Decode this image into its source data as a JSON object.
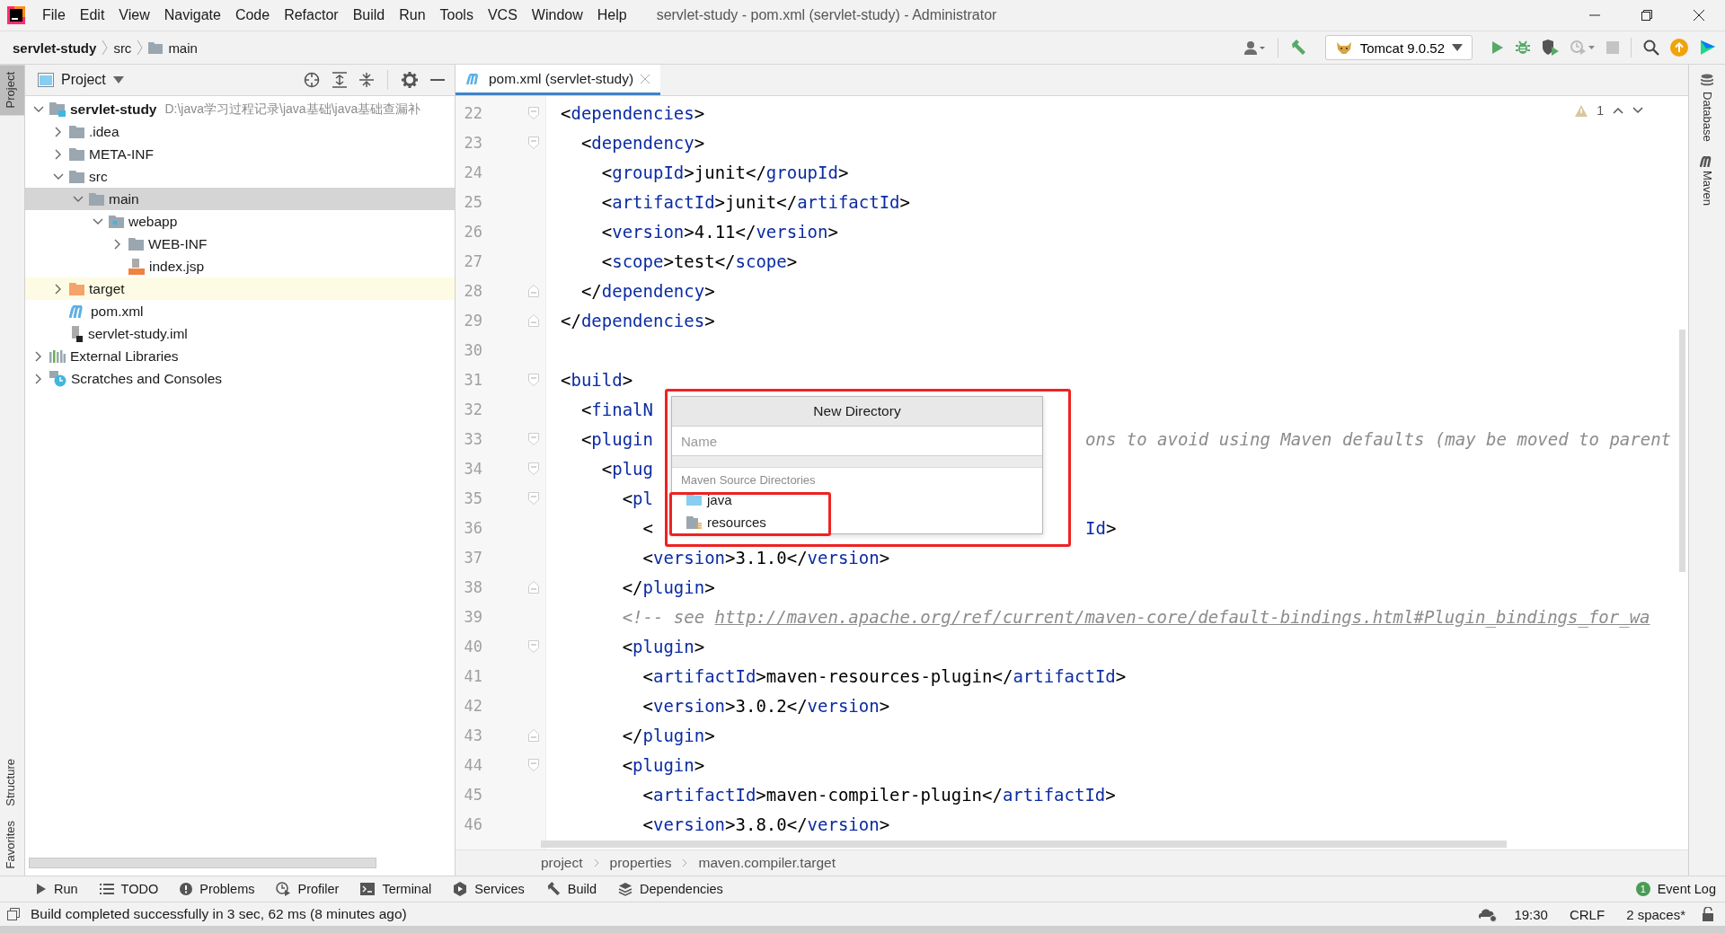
{
  "menu": [
    "File",
    "Edit",
    "View",
    "Navigate",
    "Code",
    "Refactor",
    "Build",
    "Run",
    "Tools",
    "VCS",
    "Window",
    "Help"
  ],
  "window_title": "servlet-study - pom.xml (servlet-study) - Administrator",
  "nav_path": [
    {
      "label": "servlet-study",
      "kind": "module"
    },
    {
      "label": "src",
      "kind": "plain"
    },
    {
      "label": "main",
      "kind": "folder"
    }
  ],
  "run_config": "Tomcat 9.0.52",
  "left_stripe": [
    {
      "label": "Project",
      "selected": true,
      "kind": "top"
    },
    {
      "label": "Structure",
      "selected": false,
      "kind": "bottom"
    },
    {
      "label": "Favorites",
      "selected": false,
      "kind": "bottom"
    }
  ],
  "right_stripe": [
    {
      "label": "Database",
      "kind": "database"
    },
    {
      "label": "Maven",
      "kind": "maven"
    }
  ],
  "project": {
    "title": "Project",
    "tree": [
      {
        "label": "servlet-study",
        "path": "D:\\java学习过程记录\\java基础\\java基础查漏补",
        "kind": "module",
        "expanded": true,
        "selected": false,
        "highlighted": false,
        "children": [
          {
            "label": ".idea",
            "kind": "folder",
            "expanded": false,
            "selected": false,
            "highlighted": false
          },
          {
            "label": "META-INF",
            "kind": "folder",
            "expanded": false,
            "selected": false,
            "highlighted": false
          },
          {
            "label": "src",
            "kind": "folder",
            "expanded": true,
            "selected": false,
            "highlighted": false,
            "children": [
              {
                "label": "main",
                "kind": "folder",
                "expanded": true,
                "selected": true,
                "highlighted": false,
                "children": [
                  {
                    "label": "webapp",
                    "kind": "web",
                    "expanded": true,
                    "selected": false,
                    "highlighted": false,
                    "children": [
                      {
                        "label": "WEB-INF",
                        "kind": "folder",
                        "expanded": false,
                        "selected": false,
                        "highlighted": false
                      },
                      {
                        "label": "index.jsp",
                        "kind": "jsp",
                        "selected": false,
                        "highlighted": false
                      }
                    ]
                  }
                ]
              }
            ]
          },
          {
            "label": "target",
            "kind": "excluded",
            "expanded": false,
            "selected": false,
            "highlighted": true
          },
          {
            "label": "pom.xml",
            "kind": "maven",
            "selected": false,
            "highlighted": false
          },
          {
            "label": "servlet-study.iml",
            "kind": "iml",
            "selected": false,
            "highlighted": false
          }
        ]
      },
      {
        "label": "External Libraries",
        "kind": "libraries",
        "expanded": false,
        "selected": false,
        "highlighted": false
      },
      {
        "label": "Scratches and Consoles",
        "kind": "scratches",
        "expanded": false,
        "selected": false,
        "highlighted": false
      }
    ]
  },
  "editor": {
    "tabs": [
      {
        "label": "pom.xml (servlet-study)",
        "selected": true
      }
    ],
    "warnings": "1",
    "lines": [
      {
        "n": "22",
        "kind": "fold-start",
        "code": "<dependencies>"
      },
      {
        "n": "23",
        "kind": "fold-start",
        "code": "  <dependency>"
      },
      {
        "n": "24",
        "code": "    <groupId>junit</groupId>"
      },
      {
        "n": "25",
        "code": "    <artifactId>junit</artifactId>"
      },
      {
        "n": "26",
        "code": "    <version>4.11</version>"
      },
      {
        "n": "27",
        "code": "    <scope>test</scope>"
      },
      {
        "n": "28",
        "kind": "fold-end",
        "code": "  </dependency>"
      },
      {
        "n": "29",
        "kind": "fold-end",
        "code": "</dependencies>"
      },
      {
        "n": "30"
      },
      {
        "n": "31",
        "kind": "fold-start",
        "code": "<build>"
      },
      {
        "n": "32",
        "code": "  <finalN"
      },
      {
        "n": "33",
        "kind": "fold-start",
        "code": "  <plugin",
        "after": {
          "kind": "comment",
          "text": "ons to avoid using Maven defaults (may be moved to parent"
        }
      },
      {
        "n": "34",
        "kind": "fold-start",
        "code": "    <plug"
      },
      {
        "n": "35",
        "kind": "fold-start",
        "code": "      <pl"
      },
      {
        "n": "36",
        "code": "        <",
        "after": {
          "kind": "tag-end",
          "text": "Id>"
        }
      },
      {
        "n": "37",
        "code": "        <version>3.1.0</version>"
      },
      {
        "n": "38",
        "kind": "fold-end",
        "code": "      </plugin>"
      },
      {
        "n": "39",
        "kind": "comment",
        "code": "      <!-- see ",
        "link": "http://maven.apache.org/ref/current/maven-core/default-bindings.html#Plugin_bindings_for_wa"
      },
      {
        "n": "40",
        "kind": "fold-start",
        "code": "      <plugin>"
      },
      {
        "n": "41",
        "code": "        <artifactId>maven-resources-plugin</artifactId>"
      },
      {
        "n": "42",
        "code": "        <version>3.0.2</version>"
      },
      {
        "n": "43",
        "kind": "fold-end",
        "code": "      </plugin>"
      },
      {
        "n": "44",
        "kind": "fold-start",
        "code": "      <plugin>"
      },
      {
        "n": "45",
        "code": "        <artifactId>maven-compiler-plugin</artifactId>"
      },
      {
        "n": "46",
        "code": "        <version>3.8.0</version>"
      }
    ]
  },
  "dialog": {
    "title": "New Directory",
    "placeholder": "Name",
    "section": "Maven Source Directories",
    "items": [
      {
        "label": "java",
        "kind": "source"
      },
      {
        "label": "resources",
        "kind": "resources"
      }
    ]
  },
  "breadcrumbs": [
    "project",
    "properties",
    "maven.compiler.target"
  ],
  "tool_tabs": [
    {
      "label": "Run",
      "kind": "run"
    },
    {
      "label": "TODO",
      "kind": "todo"
    },
    {
      "label": "Problems",
      "kind": "problems"
    },
    {
      "label": "Profiler",
      "kind": "profiler"
    },
    {
      "label": "Terminal",
      "kind": "terminal"
    },
    {
      "label": "Services",
      "kind": "services"
    },
    {
      "label": "Build",
      "kind": "build"
    },
    {
      "label": "Dependencies",
      "kind": "dependencies"
    }
  ],
  "event_log": {
    "count": "1",
    "label": "Event Log"
  },
  "status": {
    "message": "Build completed successfully in 3 sec, 62 ms (8 minutes ago)",
    "position": "19:30",
    "line_separator": "CRLF",
    "indent": "2 spaces*"
  }
}
